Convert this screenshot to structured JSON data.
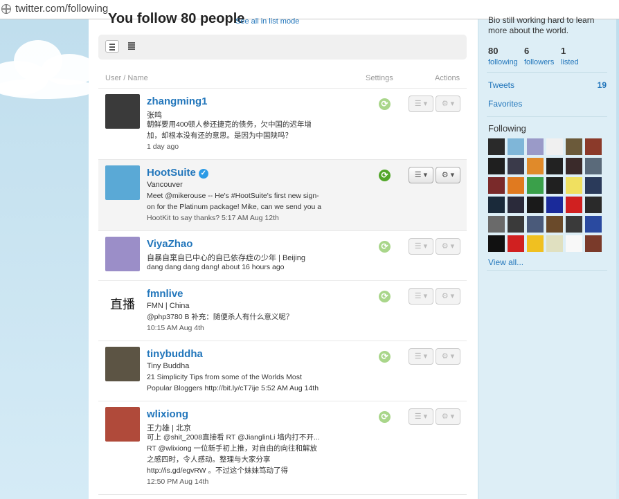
{
  "address_bar": {
    "url": "twitter.com/following"
  },
  "main": {
    "heading": "You follow 80 people",
    "heading_link": "See all in list mode",
    "columns": {
      "user": "User / Name",
      "settings": "Settings",
      "actions": "Actions"
    },
    "rows": [
      {
        "username": "zhangming1",
        "verified": false,
        "realname": "张鸣",
        "tweet_lines": [
          "朝鲜要用400顿人参还捷克的债务，欠中国的迟年增",
          "加，却根本没有还的意思。是因为中国陕吗？"
        ],
        "meta": "1 day ago",
        "retweets_on": false,
        "avatar_color": "#3a3a3a"
      },
      {
        "username": "HootSuite",
        "verified": true,
        "realname": "Vancouver",
        "tweet_lines": [
          "Meet @mikerouse -- He's #HootSuite's first new sign-",
          "on for the Platinum package! Mike, can we send you a"
        ],
        "meta": "HootKit to say thanks?  5:17 AM Aug 12th",
        "retweets_on": true,
        "avatar_color": "#5aa9d6"
      },
      {
        "username": "ViyaZhao",
        "verified": false,
        "realname": "自暴自棄自已中心的自已依存症の少年 | Beijing",
        "tweet_lines": [
          "dang dang dang dang!  about 16 hours ago"
        ],
        "meta": "",
        "retweets_on": false,
        "avatar_color": "#9b8ec8"
      },
      {
        "username": "fmnlive",
        "verified": false,
        "realname": "FMN | China",
        "tweet_lines": [
          "@php3780 B 补充：随便杀人有什么意义呢？"
        ],
        "meta": "10:15 AM Aug 4th",
        "retweets_on": false,
        "avatar_color": "#ffffff",
        "avatar_text": "直播"
      },
      {
        "username": "tinybuddha",
        "verified": false,
        "realname": "Tiny Buddha",
        "tweet_lines": [
          "21 Simplicity Tips from some of the Worlds Most",
          "Popular Bloggers http://bit.ly/cT7ije  5:52 AM Aug 14th"
        ],
        "meta": "",
        "retweets_on": false,
        "avatar_color": "#5c5444"
      },
      {
        "username": "wlixiong",
        "verified": false,
        "realname": "王力雄 | 北京",
        "tweet_lines": [
          "可上 @shit_2008直接看 RT @JianglinLi 墙内打不开...",
          "RT @wlixiong 一位新手初上推，对自由的向往和解放",
          "之感四时，令人感动。整理与大家分享",
          "http://is.gd/egvRW 。不过这个妹妹笃动了得"
        ],
        "meta": "12:50 PM Aug 14th",
        "retweets_on": false,
        "avatar_color": "#b04a3a"
      }
    ]
  },
  "sidebar": {
    "bio": "Bio still working hard to learn more about the world.",
    "stats": [
      {
        "num": "80",
        "label": "following"
      },
      {
        "num": "6",
        "label": "followers"
      },
      {
        "num": "1",
        "label": "listed"
      }
    ],
    "tweets_label": "Tweets",
    "tweets_count": "19",
    "favorites_label": "Favorites",
    "following_title": "Following",
    "view_all": "View all...",
    "grid_colors": [
      "#2a2a2a",
      "#7fb6d8",
      "#9a9ac8",
      "#f0f0f0",
      "#6b5a3a",
      "#8b3a2a",
      "#1f1f1f",
      "#3a3a4a",
      "#e08a2a",
      "#222222",
      "#3a2a2a",
      "#5a6a7a",
      "#7a2a2a",
      "#e07a20",
      "#3aa04a",
      "#202020",
      "#f0e060",
      "#2a3a5a",
      "#1a2a3a",
      "#2a2a3a",
      "#1a1a1a",
      "#1a2a9a",
      "#d02020",
      "#2a2a2a",
      "#6a6a6a",
      "#3a3a3a",
      "#4a5a7a",
      "#6a4a2a",
      "#3a3a3a",
      "#2a4aa0",
      "#111111",
      "#d02020",
      "#f0c020",
      "#e0e0c0",
      "#f8f8f8",
      "#7a3a2a"
    ]
  }
}
